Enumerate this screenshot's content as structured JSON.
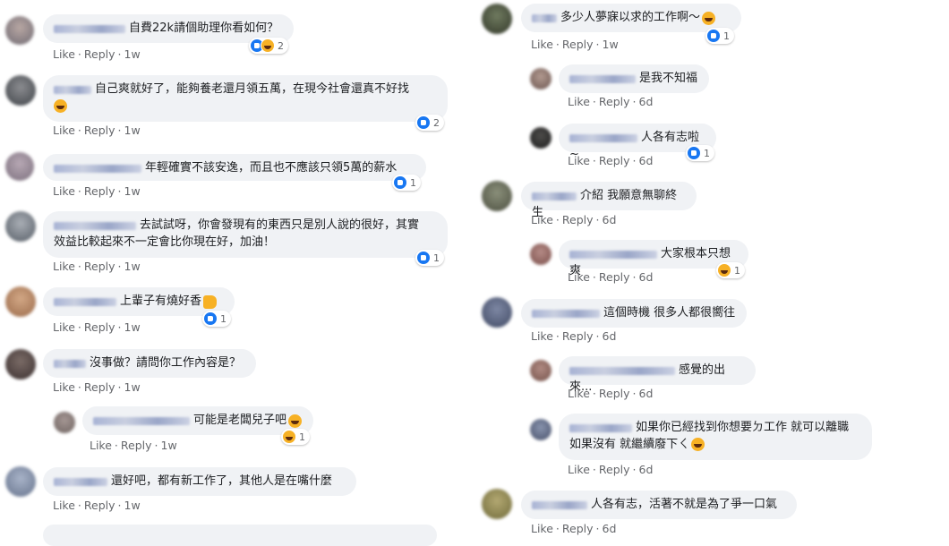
{
  "actions": {
    "like": "Like",
    "reply": "Reply"
  },
  "left_comments": [
    {
      "text": "自費22k請個助理你看如何？",
      "time": "1w",
      "reactions": "2"
    },
    {
      "text": "自己爽就好了，能夠養老還月領五萬，在現今社會還真不好找",
      "time": "1w",
      "reactions": "2"
    },
    {
      "text": "年輕確實不該安逸，而且也不應該只領5萬的薪水",
      "time": "1w",
      "reactions": "1"
    },
    {
      "text_line1": "去試試呀，你會發現有的東西只是別人說的很好，其實",
      "text_line2": "效益比較起來不一定會比你現在好，加油！",
      "time": "1w",
      "reactions": "1"
    },
    {
      "text": "上輩子有燒好香",
      "time": "1w",
      "reactions": "1"
    },
    {
      "text": "沒事做？請問你工作內容是？",
      "time": "1w"
    },
    {
      "text": "可能是老闆兒子吧",
      "time": "1w",
      "reactions": "1"
    },
    {
      "text": "還好吧，都有新工作了，其他人是在嘴什麼",
      "time": "1w"
    }
  ],
  "right_comments": [
    {
      "text": "多少人夢寐以求的工作啊～",
      "time": "1w",
      "reactions": "1"
    },
    {
      "text": "是我不知福",
      "time": "6d"
    },
    {
      "text": "人各有志啦~",
      "time": "6d",
      "reactions": "1"
    },
    {
      "text": "介紹 我願意無聊終生",
      "time": "6d"
    },
    {
      "text": "大家根本只想爽",
      "time": "6d",
      "reactions": "1"
    },
    {
      "text": "這個時機 很多人都很嚮往",
      "time": "6d"
    },
    {
      "text": "感覺的出來...",
      "time": "6d"
    },
    {
      "text_line1": "如果你已經找到你想要ㄉ工作 就可以離職",
      "text_line2": "如果沒有 就繼續廢下ㄑ",
      "time": "6d"
    },
    {
      "text": "人各有志，活著不就是為了爭一口氣",
      "time": "6d"
    }
  ]
}
